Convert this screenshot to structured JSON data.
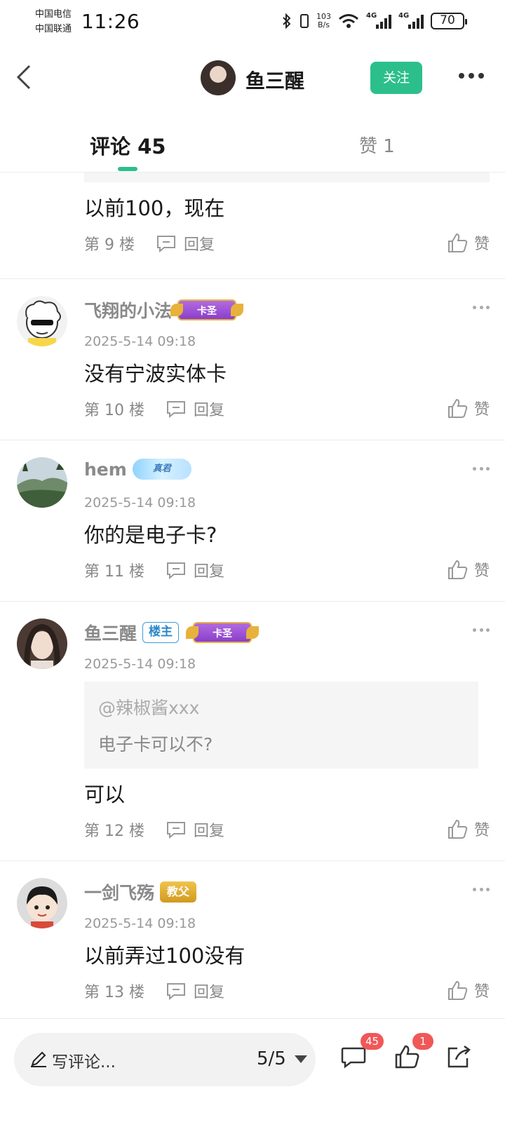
{
  "status_bar": {
    "carrier_1": "中国电信",
    "carrier_2": "中国联通",
    "time": "11:26",
    "net_speed_value": "103",
    "net_speed_unit": "B/s",
    "signal_1_label": "4G",
    "signal_2_label": "4G",
    "battery": "70"
  },
  "header": {
    "title": "鱼三醒",
    "follow_label": "关注"
  },
  "tabs": {
    "comments_label": "评论 45",
    "likes_label": "赞 1"
  },
  "previous_comment": {
    "text": "以前100，现在",
    "floor": "第 9 楼",
    "reply_label": "回复",
    "like_label": "赞"
  },
  "comments": [
    {
      "author": "飞翔的小法",
      "badge": "卡圣",
      "time": "2025-5-14 09:18",
      "text": "没有宁波实体卡",
      "floor": "第 10 楼",
      "reply_label": "回复",
      "like_label": "赞"
    },
    {
      "author": "hem",
      "badge": "真君",
      "time": "2025-5-14 09:18",
      "text": "你的是电子卡?",
      "floor": "第 11 楼",
      "reply_label": "回复",
      "like_label": "赞"
    },
    {
      "author": "鱼三醒",
      "owner_badge": "楼主",
      "badge": "卡圣",
      "time": "2025-5-14 09:18",
      "quote_author": "@辣椒酱xxx",
      "quote_text": "电子卡可以不?",
      "text": "可以",
      "floor": "第 12 楼",
      "reply_label": "回复",
      "like_label": "赞"
    },
    {
      "author": "一剑飞殇",
      "badge": "教父",
      "time": "2025-5-14 09:18",
      "text": "以前弄过100没有",
      "floor": "第 13 楼",
      "reply_label": "回复",
      "like_label": "赞"
    }
  ],
  "bottom_bar": {
    "input_placeholder": "写评论...",
    "page_indicator": "5/5",
    "comment_count": "45",
    "like_count": "1"
  },
  "colors": {
    "accent": "#2cbf8c",
    "notification": "#f05858"
  }
}
